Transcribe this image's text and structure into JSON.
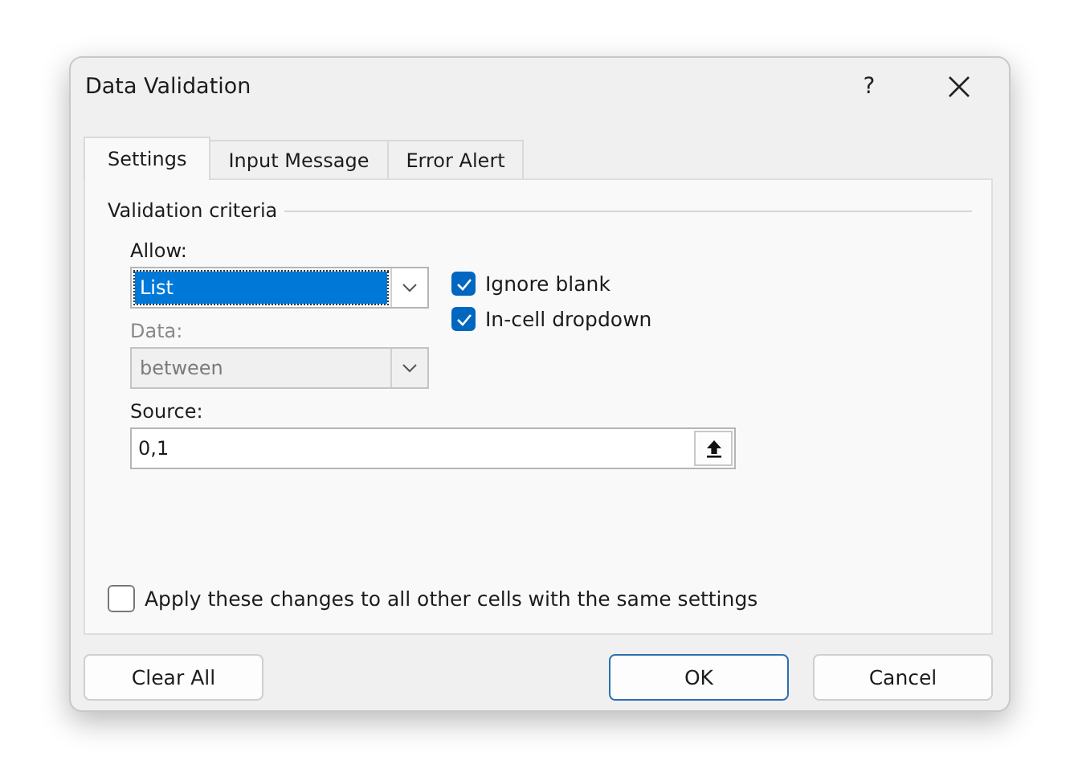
{
  "window": {
    "title": "Data Validation",
    "help": "?"
  },
  "tabs": [
    {
      "label": "Settings",
      "selected": true
    },
    {
      "label": "Input Message",
      "selected": false
    },
    {
      "label": "Error Alert",
      "selected": false
    }
  ],
  "group": {
    "title": "Validation criteria"
  },
  "allow": {
    "label": "Allow:",
    "value": "List",
    "selected": true
  },
  "data": {
    "label": "Data:",
    "value": "between",
    "disabled": true
  },
  "checkboxes": [
    {
      "label": "Ignore blank",
      "checked": true
    },
    {
      "label": "In-cell dropdown",
      "checked": true
    }
  ],
  "source": {
    "label": "Source:",
    "value": "0,1"
  },
  "apply_all": {
    "label": "Apply these changes to all other cells with the same settings",
    "checked": false
  },
  "buttons": [
    {
      "label": "Clear All",
      "default": false
    },
    {
      "label": "OK",
      "default": true
    },
    {
      "label": "Cancel",
      "default": false
    }
  ]
}
